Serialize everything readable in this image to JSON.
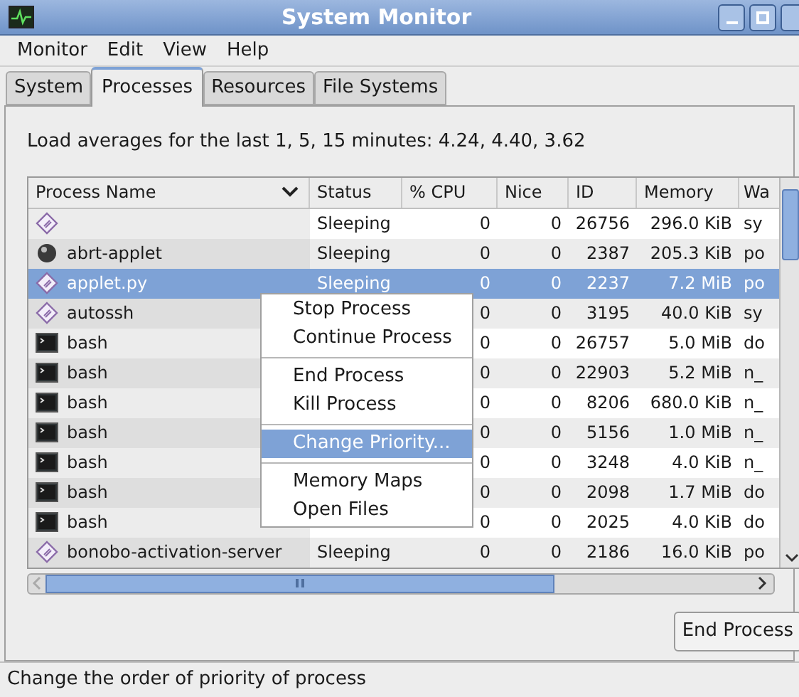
{
  "window": {
    "title": "System Monitor"
  },
  "menubar": [
    "Monitor",
    "Edit",
    "View",
    "Help"
  ],
  "tabs": [
    {
      "label": "System",
      "selected": false
    },
    {
      "label": "Processes",
      "selected": true
    },
    {
      "label": "Resources",
      "selected": false
    },
    {
      "label": "File Systems",
      "selected": false
    }
  ],
  "load_averages": "Load averages for the last 1, 5, 15 minutes: 4.24, 4.40, 3.62",
  "table": {
    "columns": [
      "Process Name",
      "Status",
      "% CPU",
      "Nice",
      "ID",
      "Memory",
      "Wa"
    ],
    "rows": [
      {
        "kind": "script",
        "status": "Sleeping",
        "cpu": "0",
        "nice": "0",
        "id": "26756",
        "memory": "296.0 KiB",
        "column_7": "sy",
        "selected": false
      },
      {
        "kind": "ball",
        "name": "abrt-applet",
        "status": "Sleeping",
        "cpu": "0",
        "nice": "0",
        "id": "2387",
        "memory": "205.3 KiB",
        "column_7": "po",
        "selected": false
      },
      {
        "kind": "script",
        "name": "applet.py",
        "status": "Sleeping",
        "cpu": "0",
        "nice": "0",
        "id": "2237",
        "memory": "7.2 MiB",
        "column_7": "po",
        "selected": true
      },
      {
        "kind": "script",
        "name": "autossh",
        "cpu": "0",
        "nice": "0",
        "id": "3195",
        "memory": "40.0 KiB",
        "column_7": "sy",
        "selected": false
      },
      {
        "kind": "terminal",
        "name": "bash",
        "cpu": "0",
        "nice": "0",
        "id": "26757",
        "memory": "5.0 MiB",
        "column_7": "do",
        "selected": false
      },
      {
        "kind": "terminal",
        "name": "bash",
        "cpu": "0",
        "nice": "0",
        "id": "22903",
        "memory": "5.2 MiB",
        "column_7": "n_",
        "selected": false
      },
      {
        "kind": "terminal",
        "name": "bash",
        "cpu": "0",
        "nice": "0",
        "id": "8206",
        "memory": "680.0 KiB",
        "column_7": "n_",
        "selected": false
      },
      {
        "kind": "terminal",
        "name": "bash",
        "cpu": "0",
        "nice": "0",
        "id": "5156",
        "memory": "1.0 MiB",
        "column_7": "n_",
        "selected": false
      },
      {
        "kind": "terminal",
        "name": "bash",
        "cpu": "0",
        "nice": "0",
        "id": "3248",
        "memory": "4.0 KiB",
        "column_7": "n_",
        "selected": false
      },
      {
        "kind": "terminal",
        "name": "bash",
        "cpu": "0",
        "nice": "0",
        "id": "2098",
        "memory": "1.7 MiB",
        "column_7": "do",
        "selected": false
      },
      {
        "kind": "terminal",
        "name": "bash",
        "cpu": "0",
        "nice": "0",
        "id": "2025",
        "memory": "4.0 KiB",
        "column_7": "do",
        "selected": false
      },
      {
        "kind": "script",
        "name": "bonobo-activation-server",
        "status": "Sleeping",
        "cpu": "0",
        "nice": "0",
        "id": "2186",
        "memory": "16.0 KiB",
        "column_7": "po",
        "selected": false
      }
    ]
  },
  "context_menu": [
    {
      "kind": "item",
      "label": "Stop Process",
      "selected": false
    },
    {
      "kind": "item",
      "label": "Continue Process",
      "selected": false
    },
    {
      "kind": "separator"
    },
    {
      "kind": "item",
      "label": "End Process",
      "selected": false
    },
    {
      "kind": "item",
      "label": "Kill Process",
      "selected": false
    },
    {
      "kind": "separator"
    },
    {
      "kind": "item",
      "label": "Change Priority...",
      "selected": true
    },
    {
      "kind": "separator"
    },
    {
      "kind": "item",
      "label": "Memory Maps",
      "selected": false
    },
    {
      "kind": "item",
      "label": "Open Files",
      "selected": false
    }
  ],
  "end_process_button": "End Process",
  "status_bar": "Change the order of priority of process"
}
